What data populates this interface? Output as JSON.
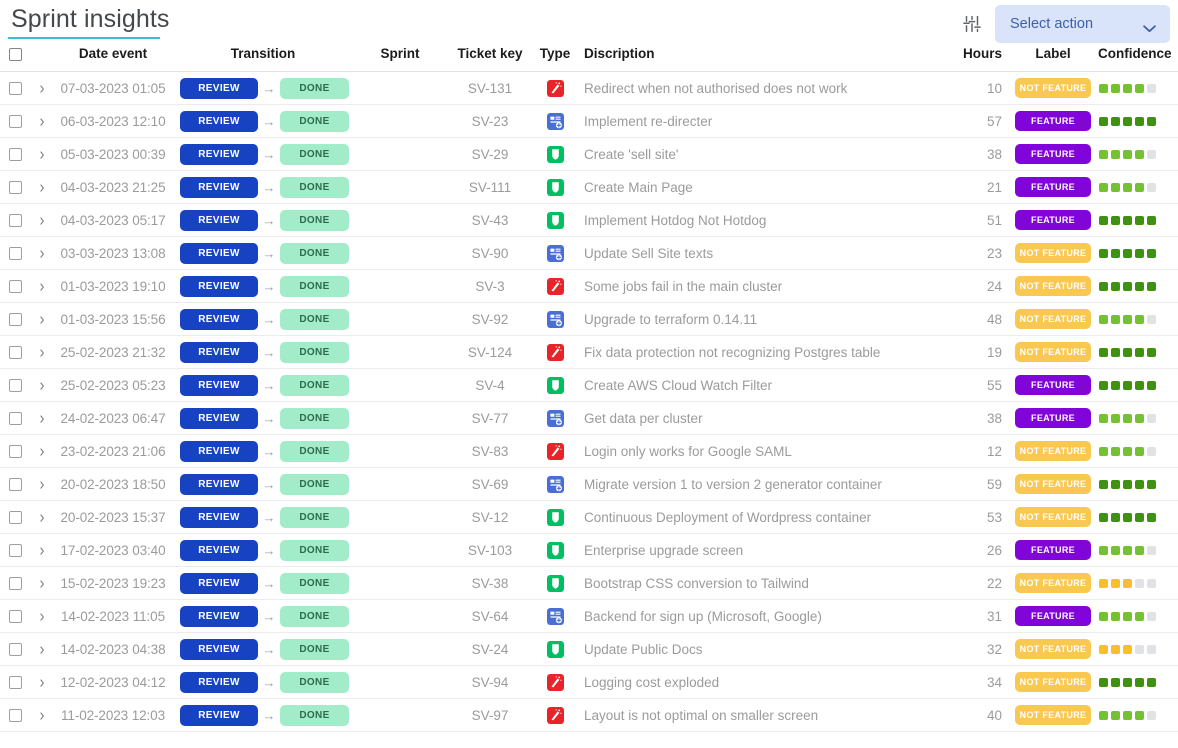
{
  "header": {
    "title": "Sprint insights",
    "accent_underline": "#35c0d6",
    "filter_icon": "sliders-filter-icon",
    "select_action": {
      "label": "Select action",
      "chevron_icon": "chevron-down-icon",
      "background": "#d9e4fb",
      "text_color": "#3f5fa8"
    }
  },
  "table": {
    "columns": [
      {
        "key": "check",
        "label": ""
      },
      {
        "key": "expand",
        "label": ""
      },
      {
        "key": "date",
        "label": "Date event"
      },
      {
        "key": "trans",
        "label": "Transition"
      },
      {
        "key": "sprint",
        "label": "Sprint"
      },
      {
        "key": "ticket",
        "label": "Ticket key"
      },
      {
        "key": "type",
        "label": "Type"
      },
      {
        "key": "desc",
        "label": "Discription"
      },
      {
        "key": "hours",
        "label": "Hours"
      },
      {
        "key": "label",
        "label": "Label"
      },
      {
        "key": "conf",
        "label": "Confidence"
      }
    ],
    "transition": {
      "from": "REVIEW",
      "to": "DONE",
      "arrow_icon": "arrow-right-icon"
    },
    "labels": {
      "feature": "FEATURE",
      "not_feature": "NOT FEATURE"
    },
    "colors": {
      "badge_from": "#1743c3",
      "badge_to": "#a3ecc9",
      "feature": "#8104d8",
      "not_feature": "#f9c851",
      "conf_high": "#3f9112",
      "conf_mid": "#74c231",
      "conf_low": "#f7c028",
      "conf_empty": "#e0e2e6"
    },
    "type_icons": {
      "bug": "bug-magic-wand-icon",
      "task": "blue-task-card-icon",
      "story": "green-story-shield-icon"
    },
    "rows": [
      {
        "date": "07-03-2023 01:05",
        "sprint": "",
        "ticket": "SV-131",
        "type": "bug",
        "desc": "Redirect when not authorised does not work",
        "hours": "10",
        "label": "NOT FEATURE",
        "conf": 4
      },
      {
        "date": "06-03-2023 12:10",
        "sprint": "",
        "ticket": "SV-23",
        "type": "task",
        "desc": "Implement re-directer",
        "hours": "57",
        "label": "FEATURE",
        "conf": 5
      },
      {
        "date": "05-03-2023 00:39",
        "sprint": "",
        "ticket": "SV-29",
        "type": "story",
        "desc": "Create 'sell site'",
        "hours": "38",
        "label": "FEATURE",
        "conf": 4
      },
      {
        "date": "04-03-2023 21:25",
        "sprint": "",
        "ticket": "SV-111",
        "type": "story",
        "desc": "Create Main Page",
        "hours": "21",
        "label": "FEATURE",
        "conf": 4
      },
      {
        "date": "04-03-2023 05:17",
        "sprint": "",
        "ticket": "SV-43",
        "type": "story",
        "desc": "Implement Hotdog Not Hotdog",
        "hours": "51",
        "label": "FEATURE",
        "conf": 5
      },
      {
        "date": "03-03-2023 13:08",
        "sprint": "",
        "ticket": "SV-90",
        "type": "task",
        "desc": "Update Sell Site texts",
        "hours": "23",
        "label": "NOT FEATURE",
        "conf": 5
      },
      {
        "date": "01-03-2023 19:10",
        "sprint": "",
        "ticket": "SV-3",
        "type": "bug",
        "desc": "Some jobs fail in the main cluster",
        "hours": "24",
        "label": "NOT FEATURE",
        "conf": 5
      },
      {
        "date": "01-03-2023 15:56",
        "sprint": "",
        "ticket": "SV-92",
        "type": "task",
        "desc": "Upgrade to terraform 0.14.11",
        "hours": "48",
        "label": "NOT FEATURE",
        "conf": 4
      },
      {
        "date": "25-02-2023 21:32",
        "sprint": "",
        "ticket": "SV-124",
        "type": "bug",
        "desc": "Fix data protection not recognizing Postgres table",
        "hours": "19",
        "label": "NOT FEATURE",
        "conf": 5
      },
      {
        "date": "25-02-2023 05:23",
        "sprint": "",
        "ticket": "SV-4",
        "type": "story",
        "desc": "Create AWS Cloud Watch Filter",
        "hours": "55",
        "label": "FEATURE",
        "conf": 5
      },
      {
        "date": "24-02-2023 06:47",
        "sprint": "",
        "ticket": "SV-77",
        "type": "task",
        "desc": "Get data per cluster",
        "hours": "38",
        "label": "FEATURE",
        "conf": 4
      },
      {
        "date": "23-02-2023 21:06",
        "sprint": "",
        "ticket": "SV-83",
        "type": "bug",
        "desc": "Login only works for Google SAML",
        "hours": "12",
        "label": "NOT FEATURE",
        "conf": 4
      },
      {
        "date": "20-02-2023 18:50",
        "sprint": "",
        "ticket": "SV-69",
        "type": "task",
        "desc": "Migrate version 1 to version 2 generator container",
        "hours": "59",
        "label": "NOT FEATURE",
        "conf": 5
      },
      {
        "date": "20-02-2023 15:37",
        "sprint": "",
        "ticket": "SV-12",
        "type": "story",
        "desc": "Continuous Deployment of Wordpress container",
        "hours": "53",
        "label": "NOT FEATURE",
        "conf": 5
      },
      {
        "date": "17-02-2023 03:40",
        "sprint": "",
        "ticket": "SV-103",
        "type": "story",
        "desc": "Enterprise upgrade screen",
        "hours": "26",
        "label": "FEATURE",
        "conf": 4
      },
      {
        "date": "15-02-2023 19:23",
        "sprint": "",
        "ticket": "SV-38",
        "type": "story",
        "desc": "Bootstrap CSS conversion to Tailwind",
        "hours": "22",
        "label": "NOT FEATURE",
        "conf": 3
      },
      {
        "date": "14-02-2023 11:05",
        "sprint": "",
        "ticket": "SV-64",
        "type": "task",
        "desc": "Backend for sign up (Microsoft, Google)",
        "hours": "31",
        "label": "FEATURE",
        "conf": 4
      },
      {
        "date": "14-02-2023 04:38",
        "sprint": "",
        "ticket": "SV-24",
        "type": "story",
        "desc": "Update Public Docs",
        "hours": "32",
        "label": "NOT FEATURE",
        "conf": 3
      },
      {
        "date": "12-02-2023 04:12",
        "sprint": "",
        "ticket": "SV-94",
        "type": "bug",
        "desc": "Logging cost exploded",
        "hours": "34",
        "label": "NOT FEATURE",
        "conf": 5
      },
      {
        "date": "11-02-2023 12:03",
        "sprint": "",
        "ticket": "SV-97",
        "type": "bug",
        "desc": "Layout is not optimal on smaller screen",
        "hours": "40",
        "label": "NOT FEATURE",
        "conf": 4
      }
    ]
  }
}
